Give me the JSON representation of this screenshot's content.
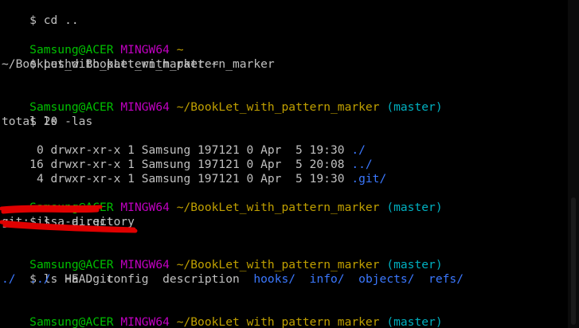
{
  "colors": {
    "background": "#000000",
    "text": "#c0c0c0",
    "user_host": "#00c000",
    "shell": "#c000c0",
    "path": "#c0a000",
    "branch": "#00b0c0",
    "directory": "#3b78ff",
    "redaction": "#e00000"
  },
  "prompt": {
    "user_host": "Samsung@ACER",
    "shell": "MINGW64",
    "home": "~",
    "repo_path": "~/BookLet_with_pattern_marker",
    "branch": "(master)",
    "symbol": "$"
  },
  "commands": {
    "cd": "cd ..",
    "pushd": "pushd BookLet_with_pattern_marker",
    "ls_las": "ls -las",
    "hidden": "ls -a .git",
    "ls_a_git": "ls -a .git"
  },
  "outputs": {
    "pushd_stack": "~/BookLet_with_pattern_marker ~",
    "total": "total 20",
    "rows": [
      {
        "meta": " 0 drwxr-xr-x 1 Samsung 197121 0 Apr  5 19:30 ",
        "name": "./"
      },
      {
        "meta": "16 drwxr-xr-x 1 Samsung 197121 0 Apr  5 20:08 ",
        "name": "../"
      },
      {
        "meta": " 4 drwxr-xr-x 1 Samsung 197121 0 Apr  5 19:30 ",
        "name": ".git/"
      }
    ],
    "hidden_line": "git: is a directory",
    "git_listing": {
      "dot": "./",
      "dotdot": "../",
      "head": "HEAD",
      "config": "config",
      "description": "description",
      "hooks": "hooks/",
      "info": "info/",
      "objects": "objects/",
      "refs": "refs/"
    }
  }
}
